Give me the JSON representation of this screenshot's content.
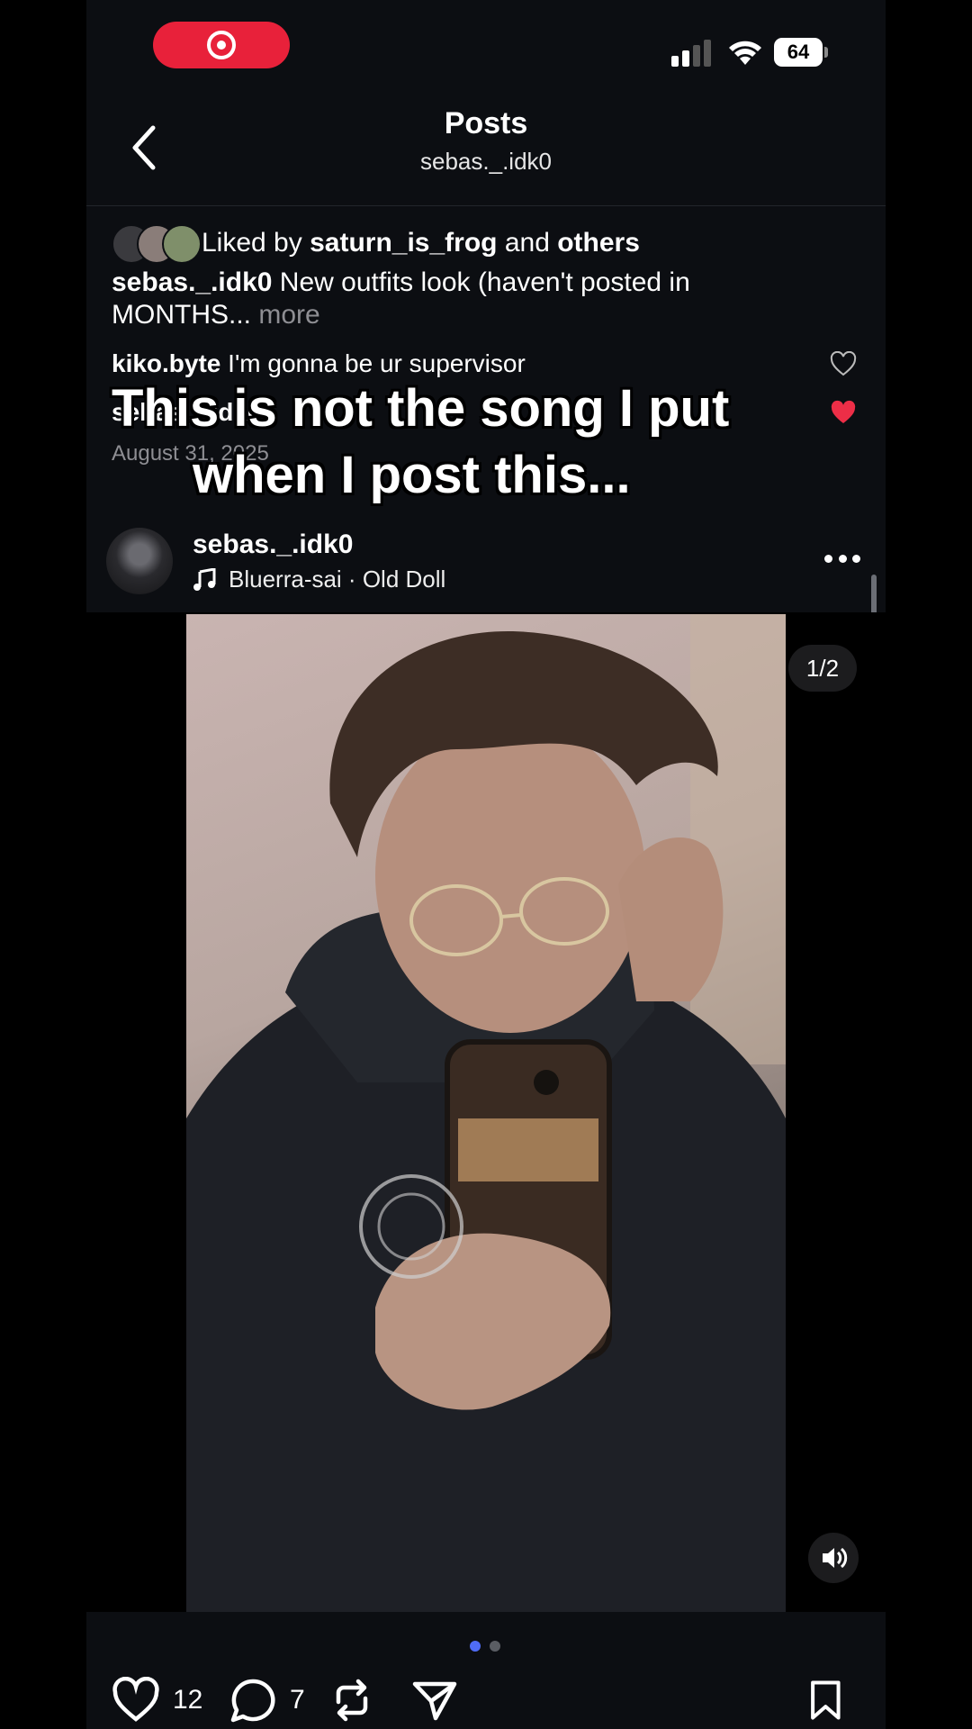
{
  "status_bar": {
    "battery": "64"
  },
  "header": {
    "title": "Posts",
    "subtitle": "sebas._.idk0"
  },
  "likes": {
    "prefix": "Liked by",
    "user": "saturn_is_frog",
    "joiner": "and",
    "others": "others"
  },
  "caption": {
    "user": "sebas._.idk0",
    "text": "New outfits look (haven't posted in MONTHS...",
    "more": "more"
  },
  "comments": [
    {
      "user": "kiko.byte",
      "text": "I'm gonna be ur supervisor",
      "liked": false
    },
    {
      "user": "sebas._.idk0",
      "text": "",
      "liked": true
    }
  ],
  "date": "August 31, 2025",
  "overlay_text": {
    "line1": "This is not the song I put",
    "line2": "when I post this..."
  },
  "post": {
    "user": "sebas._.idk0",
    "music": "Bluerra-sai · Old Doll",
    "page_counter": "1/2",
    "carousel_index": 1,
    "carousel_total": 2
  },
  "actions": {
    "likes": "12",
    "comments": "7"
  },
  "colors": {
    "accent_red": "#e8213a",
    "carousel_active": "#4f6cf5",
    "background": "#0c0e12"
  },
  "icons": [
    "record-icon",
    "cellular-signal-icon",
    "wifi-icon",
    "battery-icon",
    "back-chevron-icon",
    "heart-icon",
    "music-note-icon",
    "more-icon",
    "volume-icon",
    "comment-icon",
    "repost-icon",
    "share-icon",
    "bookmark-icon"
  ]
}
